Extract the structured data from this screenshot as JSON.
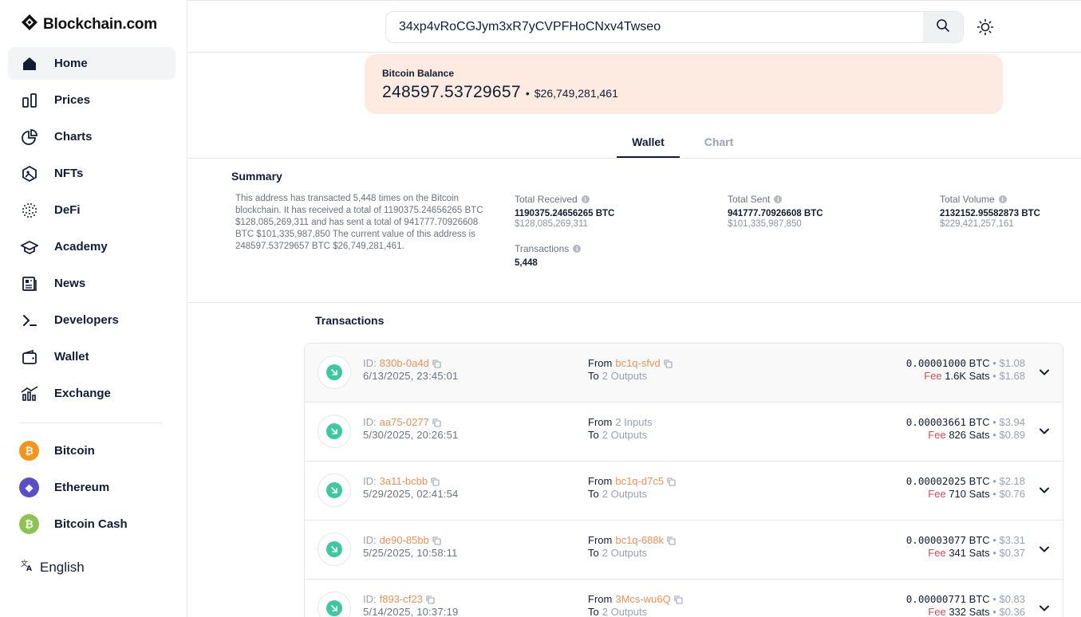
{
  "brand": {
    "name": "Blockchain.com"
  },
  "nav": [
    {
      "label": "Home",
      "icon": "home-icon"
    },
    {
      "label": "Prices",
      "icon": "prices-icon"
    },
    {
      "label": "Charts",
      "icon": "charts-icon"
    },
    {
      "label": "NFTs",
      "icon": "nfts-icon"
    },
    {
      "label": "DeFi",
      "icon": "defi-icon"
    },
    {
      "label": "Academy",
      "icon": "academy-icon"
    },
    {
      "label": "News",
      "icon": "news-icon"
    },
    {
      "label": "Developers",
      "icon": "developers-icon"
    },
    {
      "label": "Wallet",
      "icon": "wallet-icon"
    },
    {
      "label": "Exchange",
      "icon": "exchange-icon"
    }
  ],
  "coins": [
    {
      "label": "Bitcoin",
      "symbol": "₿",
      "color": "#f7931a"
    },
    {
      "label": "Ethereum",
      "symbol": "◆",
      "color": "#5b4fc9"
    },
    {
      "label": "Bitcoin Cash",
      "symbol": "₿",
      "color": "#8dc351"
    }
  ],
  "language": {
    "label": "English",
    "icon": "translate-icon"
  },
  "search": {
    "value": "34xp4vRoCGJym3xR7yCVPFHoCNxv4Twseo"
  },
  "balance": {
    "label": "Bitcoin Balance",
    "btc": "248597.53729657",
    "separator": "•",
    "usd": "$26,749,281,461"
  },
  "tabs": {
    "wallet": "Wallet",
    "chart": "Chart"
  },
  "summary": {
    "title": "Summary",
    "text": "This address has transacted 5,448 times on the Bitcoin blockchain. It has received a total of 1190375.24656265 BTC $128,085,269,311 and has sent a total of 941777.70926608 BTC $101,335,987,850 The current value of this address is 248597.53729657 BTC $26,749,281,461.",
    "total_received": {
      "label": "Total Received",
      "btc": "1190375.24656265 BTC",
      "usd": "$128,085,269,311"
    },
    "total_sent": {
      "label": "Total Sent",
      "btc": "941777.70926608 BTC",
      "usd": "$101,335,987,850"
    },
    "total_volume": {
      "label": "Total Volume",
      "btc": "2132152.95582873 BTC",
      "usd": "$229,421,257,161"
    },
    "transactions": {
      "label": "Transactions",
      "value": "5,448"
    }
  },
  "transactions": {
    "title": "Transactions",
    "id_label": "ID:",
    "from_label": "From",
    "to_label": "To",
    "fee_label": "Fee",
    "rows": [
      {
        "id": "830b-0a4d",
        "time": "6/13/2025, 23:45:01",
        "from": "bc1q-sfvd",
        "from_is_link": true,
        "to": "2 Outputs",
        "amount": "0.00001000",
        "unit": "BTC",
        "amount_usd": "• $1.08",
        "fee": "1.6K",
        "fee_unit": "Sats",
        "fee_usd": "• $1.68"
      },
      {
        "id": "aa75-0277",
        "time": "5/30/2025, 20:26:51",
        "from": "2 Inputs",
        "from_is_link": false,
        "to": "2 Outputs",
        "amount": "0.00003661",
        "unit": "BTC",
        "amount_usd": "• $3.94",
        "fee": "826",
        "fee_unit": "Sats",
        "fee_usd": "• $0.89"
      },
      {
        "id": "3a11-bcbb",
        "time": "5/29/2025, 02:41:54",
        "from": "bc1q-d7c5",
        "from_is_link": true,
        "to": "2 Outputs",
        "amount": "0.00002025",
        "unit": "BTC",
        "amount_usd": "• $2.18",
        "fee": "710",
        "fee_unit": "Sats",
        "fee_usd": "• $0.76"
      },
      {
        "id": "de90-85bb",
        "time": "5/25/2025, 10:58:11",
        "from": "bc1q-688k",
        "from_is_link": true,
        "to": "2 Outputs",
        "amount": "0.00003077",
        "unit": "BTC",
        "amount_usd": "• $3.31",
        "fee": "341",
        "fee_unit": "Sats",
        "fee_usd": "• $0.37"
      },
      {
        "id": "f893-cf23",
        "time": "5/14/2025, 10:37:19",
        "from": "3Mcs-wu6Q",
        "from_is_link": true,
        "to": "2 Outputs",
        "amount": "0.00000771",
        "unit": "BTC",
        "amount_usd": "• $0.83",
        "fee": "332",
        "fee_unit": "Sats",
        "fee_usd": "• $0.36"
      }
    ]
  }
}
